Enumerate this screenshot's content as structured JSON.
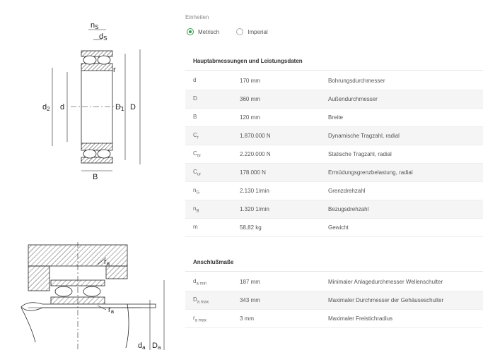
{
  "units": {
    "label": "Einheiten",
    "options": [
      {
        "label": "Metrisch",
        "selected": true
      },
      {
        "label": "Imperial",
        "selected": false
      }
    ]
  },
  "drawing_top": {
    "labels": {
      "ns": "n",
      "ns_sub": "S",
      "ds": "d",
      "ds_sub": "S",
      "r": "r",
      "d2": "d",
      "d2_sub": "2",
      "d": "d",
      "D1": "D",
      "D1_sub": "1",
      "D": "D",
      "B": "B"
    }
  },
  "drawing_bottom": {
    "labels": {
      "ra_top": "r",
      "ra_top_sub": "a",
      "ra_bottom": "r",
      "ra_bottom_sub": "a",
      "da": "d",
      "da_sub": "a",
      "Da": "D",
      "Da_sub": "a"
    }
  },
  "main_section": {
    "title": "Hauptabmessungen und Leistungsdaten",
    "rows": [
      {
        "sym": "d",
        "sub": "",
        "value": "170 mm",
        "desc": "Bohrungsdurchmesser"
      },
      {
        "sym": "D",
        "sub": "",
        "value": "360 mm",
        "desc": "Außendurchmesser"
      },
      {
        "sym": "B",
        "sub": "",
        "value": "120 mm",
        "desc": "Breite"
      },
      {
        "sym": "C",
        "sub": "r",
        "value": "1.870.000 N",
        "desc": "Dynamische Tragzahl, radial"
      },
      {
        "sym": "C",
        "sub": "0r",
        "value": "2.220.000 N",
        "desc": "Statische Tragzahl, radial"
      },
      {
        "sym": "C",
        "sub": "ur",
        "value": "178.000 N",
        "desc": "Ermüdungsgrenzbelastung, radial"
      },
      {
        "sym": "n",
        "sub": "G",
        "value": "2.130 1/min",
        "desc": "Grenzdrehzahl"
      },
      {
        "sym": "n",
        "sub": "B",
        "value": "1.320 1/min",
        "desc": "Bezugsdrehzahl"
      },
      {
        "sym": "m",
        "sub": "",
        "value": "58,82 kg",
        "desc": "Gewicht"
      }
    ]
  },
  "mounting_section": {
    "title": "Anschlußmaße",
    "rows": [
      {
        "sym": "d",
        "sub": "a min",
        "value": "187 mm",
        "desc": "Minimaler Anlagedurchmesser Wellenschulter"
      },
      {
        "sym": "D",
        "sub": "a max",
        "value": "343 mm",
        "desc": "Maximaler Durchmesser der Gehäuseschulter"
      },
      {
        "sym": "r",
        "sub": "a max",
        "value": "3 mm",
        "desc": "Maximaler Freistichradius"
      }
    ]
  }
}
